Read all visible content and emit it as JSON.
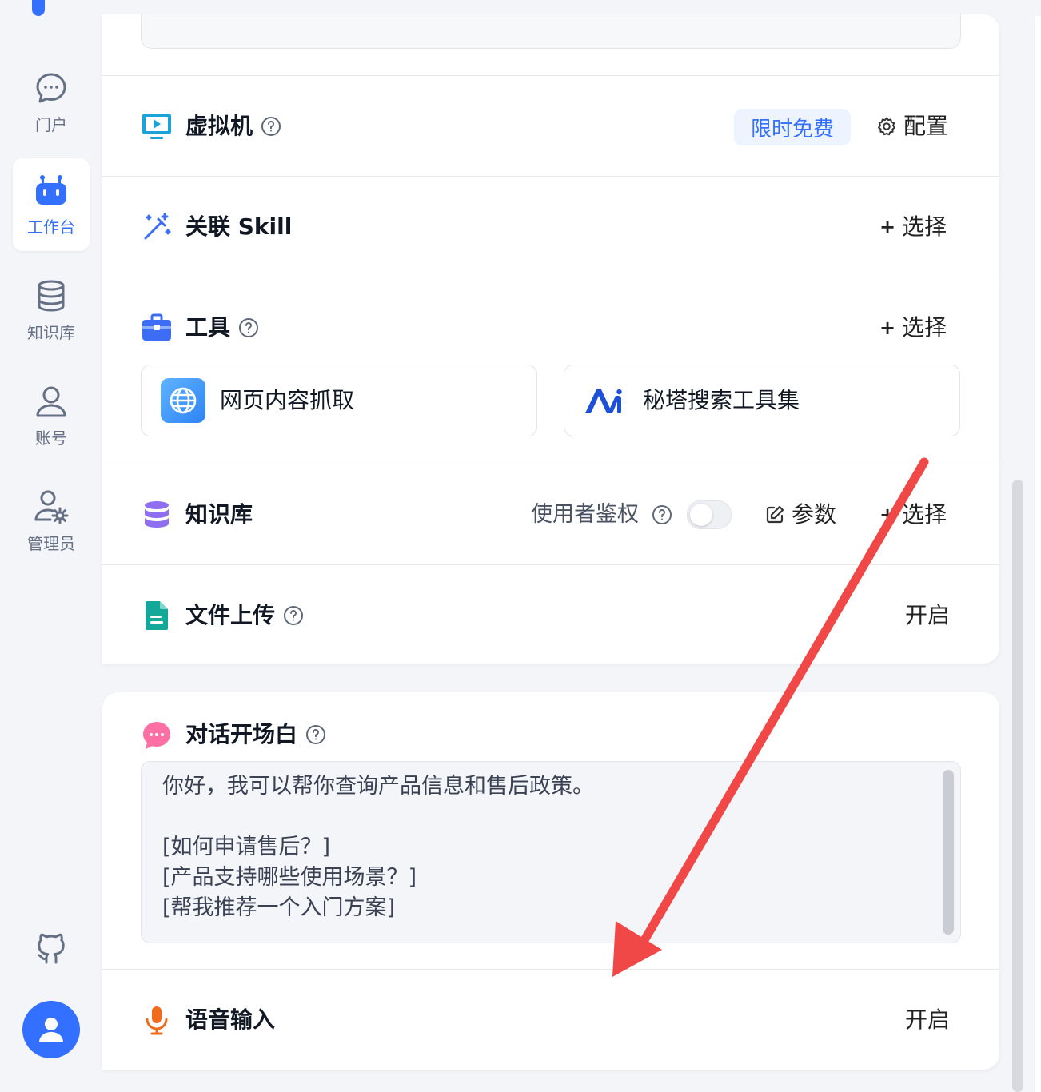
{
  "sidebar": {
    "items": [
      {
        "label": "门户",
        "icon": "chat-bubble-icon",
        "active": false
      },
      {
        "label": "工作台",
        "icon": "robot-icon",
        "active": true
      },
      {
        "label": "知识库",
        "icon": "database-icon",
        "active": false
      },
      {
        "label": "账号",
        "icon": "user-icon",
        "active": false
      },
      {
        "label": "管理员",
        "icon": "user-gear-icon",
        "active": false
      }
    ],
    "bottom_icons": [
      "github-icon",
      "user-avatar-icon"
    ]
  },
  "config": {
    "vm": {
      "title": "虚拟机",
      "badge": "限时免费",
      "action": "配置"
    },
    "skill": {
      "title": "关联 Skill",
      "action": "选择",
      "action_prefix": "+"
    },
    "tools": {
      "title": "工具",
      "action": "选择",
      "action_prefix": "+",
      "items": [
        {
          "name": "网页内容抓取",
          "icon": "globe-icon"
        },
        {
          "name": "秘塔搜索工具集",
          "icon": "metaso-logo-icon"
        }
      ]
    },
    "knowledge": {
      "title": "知识库",
      "auth_label": "使用者鉴权",
      "auth_enabled": false,
      "params": "参数",
      "action": "选择",
      "action_prefix": "+"
    },
    "upload": {
      "title": "文件上传",
      "action": "开启"
    }
  },
  "dialog": {
    "opening": {
      "title": "对话开场白",
      "text": "你好，我可以帮你查询产品信息和售后政策。\n\n[如何申请售后？]\n[产品支持哪些使用场景？]\n[帮我推荐一个入门方案]"
    },
    "voice": {
      "title": "语音输入",
      "action": "开启"
    }
  },
  "colors": {
    "accent": "#3370ff",
    "annotation_arrow": "#f04747"
  }
}
